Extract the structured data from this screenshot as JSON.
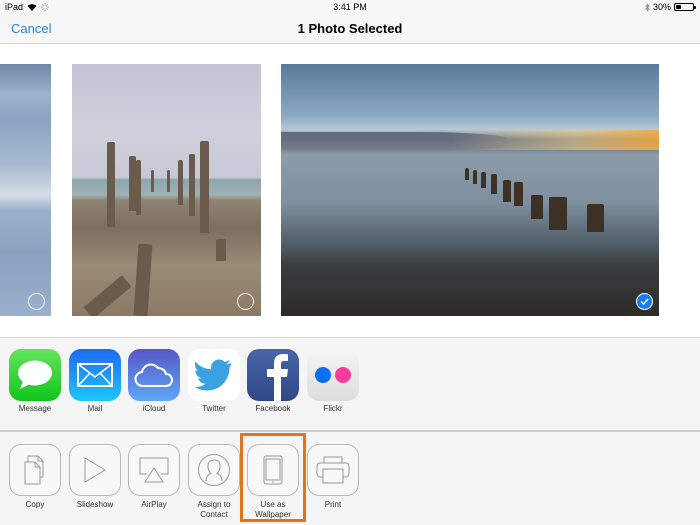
{
  "status_bar": {
    "device": "iPad",
    "time": "3:41 PM",
    "battery_percent_label": "30%",
    "battery_level": 0.3,
    "icons": [
      "wifi-icon",
      "activity-icon",
      "bluetooth-icon",
      "battery-icon"
    ]
  },
  "nav": {
    "cancel_label": "Cancel",
    "title": "1 Photo Selected"
  },
  "photos": [
    {
      "description": "Waves on shore (partially visible)",
      "selected": false
    },
    {
      "description": "Wooden pier posts on pebble beach",
      "selected": false
    },
    {
      "description": "Pier posts at sunset over calm sea",
      "selected": true
    }
  ],
  "share_apps": [
    {
      "label": "Message",
      "icon": "message-icon"
    },
    {
      "label": "Mail",
      "icon": "mail-icon"
    },
    {
      "label": "iCloud",
      "icon": "icloud-icon"
    },
    {
      "label": "Twitter",
      "icon": "twitter-icon"
    },
    {
      "label": "Facebook",
      "icon": "facebook-icon"
    },
    {
      "label": "Flickr",
      "icon": "flickr-icon"
    }
  ],
  "actions": [
    {
      "label": "Copy",
      "icon": "copy-icon"
    },
    {
      "label": "Slideshow",
      "icon": "slideshow-icon"
    },
    {
      "label": "AirPlay",
      "icon": "airplay-icon"
    },
    {
      "label": "Assign to Contact",
      "icon": "contact-icon"
    },
    {
      "label": "Use as Wallpaper",
      "icon": "wallpaper-icon",
      "highlighted": true
    },
    {
      "label": "Print",
      "icon": "print-icon"
    }
  ],
  "colors": {
    "accent": "#2a7fe0",
    "selection": "#1a7cf5",
    "highlight_box": "#e07320"
  }
}
